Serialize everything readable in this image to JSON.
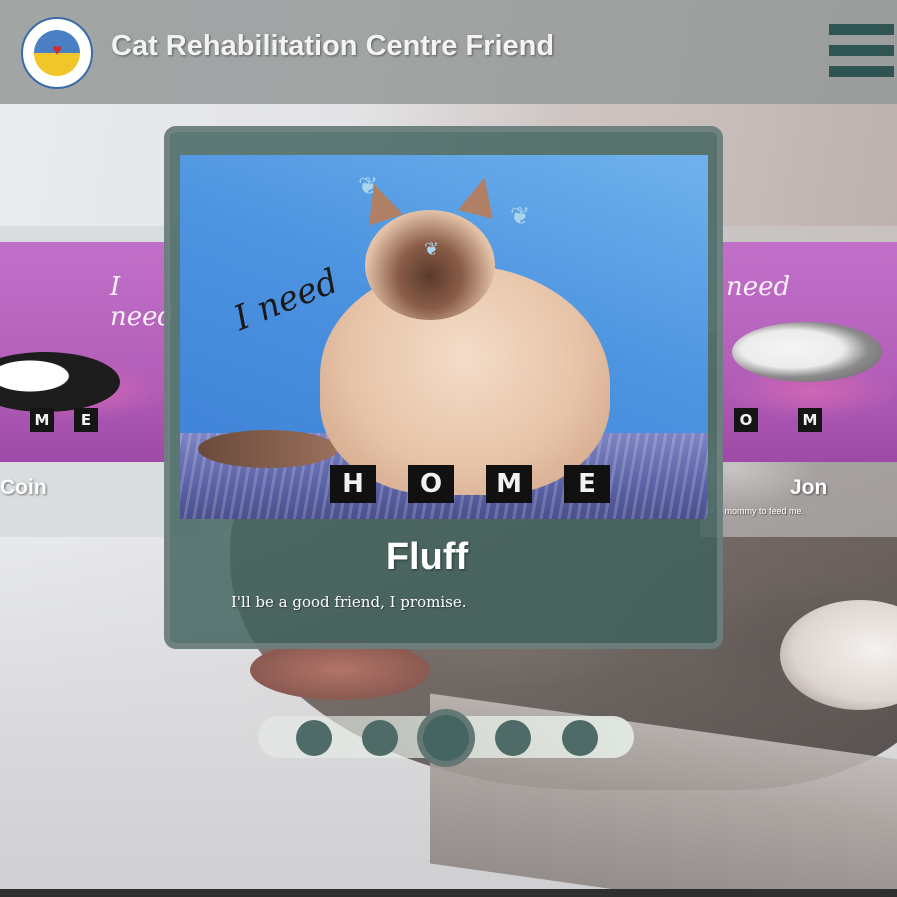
{
  "header": {
    "title": "Cat Rehabilitation Centre Friend",
    "logo_icon": "shelter-friend-logo",
    "menu_icon": "hamburger-menu-icon"
  },
  "carousel": {
    "current": {
      "name": "Fluff",
      "tagline": "I'll be a good friend, I promise.",
      "photo_text": "I need",
      "photo_blocks": [
        "H",
        "O",
        "M",
        "E"
      ]
    },
    "previous": {
      "name": "Coin",
      "photo_text": "I need",
      "photo_blocks": [
        "M",
        "E"
      ]
    },
    "next": {
      "name": "Jon",
      "tagline": "ant a mommy to feed me.",
      "photo_text": "need",
      "photo_blocks": [
        "O",
        "M"
      ]
    },
    "pagination": {
      "total": 5,
      "active_index": 3
    }
  },
  "colors": {
    "accent": "#2f5552",
    "card": "#3e605c",
    "header": "#969b9a"
  }
}
